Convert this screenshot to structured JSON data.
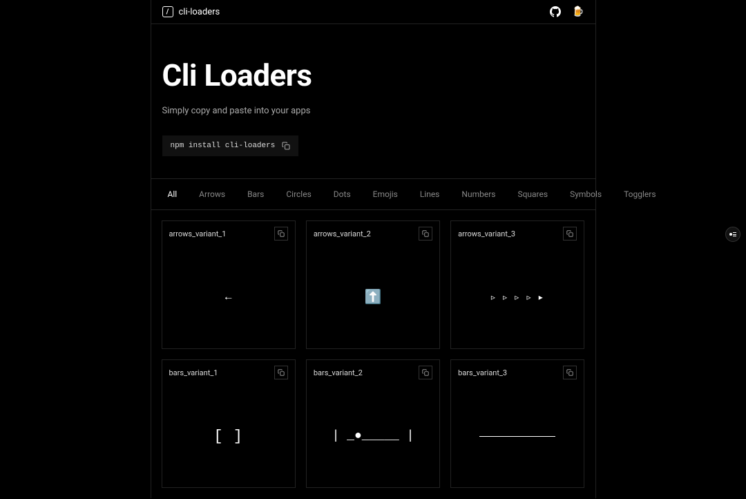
{
  "header": {
    "brand": "cli-loaders",
    "logo_char": "/"
  },
  "hero": {
    "title": "Cli Loaders",
    "subtitle": "Simply copy and paste into your apps",
    "install_cmd": "npm install cli-loaders"
  },
  "tabs": [
    {
      "label": "All",
      "active": true
    },
    {
      "label": "Arrows",
      "active": false
    },
    {
      "label": "Bars",
      "active": false
    },
    {
      "label": "Circles",
      "active": false
    },
    {
      "label": "Dots",
      "active": false
    },
    {
      "label": "Emojis",
      "active": false
    },
    {
      "label": "Lines",
      "active": false
    },
    {
      "label": "Numbers",
      "active": false
    },
    {
      "label": "Squares",
      "active": false
    },
    {
      "label": "Symbols",
      "active": false
    },
    {
      "label": "Togglers",
      "active": false
    }
  ],
  "cards": [
    {
      "title": "arrows_variant_1",
      "content": "←",
      "class": "loader-1"
    },
    {
      "title": "arrows_variant_2",
      "content": "⬆️",
      "class": "loader-2"
    },
    {
      "title": "arrows_variant_3",
      "content": "▹ ▹ ▹ ▹ ▸",
      "class": "loader-3"
    },
    {
      "title": "bars_variant_1",
      "content": "[  ]",
      "class": "loader-4"
    },
    {
      "title": "bars_variant_2",
      "content": "| _●_____ |",
      "class": "loader-5"
    },
    {
      "title": "bars_variant_3",
      "content": "                    ",
      "class": "loader-6"
    }
  ]
}
